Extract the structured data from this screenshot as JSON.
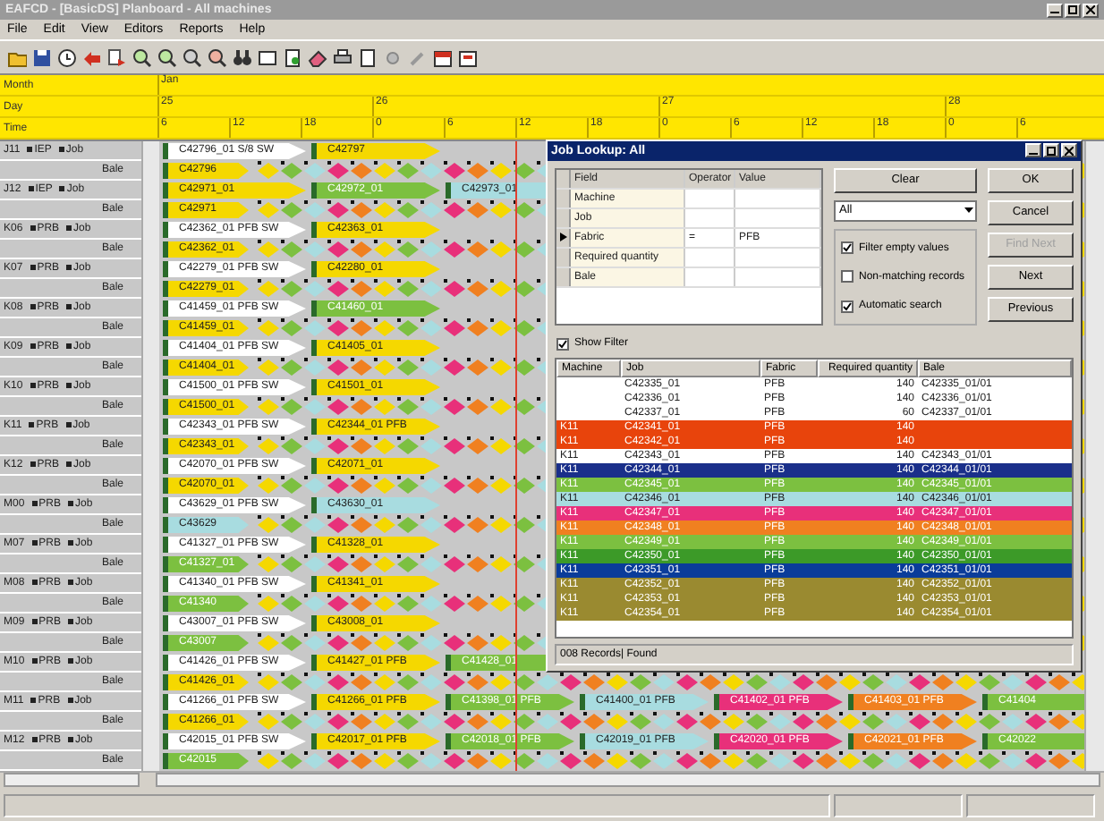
{
  "window": {
    "title": "EAFCD - [BasicDS] Planboard - All machines"
  },
  "menu": [
    "File",
    "Edit",
    "View",
    "Editors",
    "Reports",
    "Help"
  ],
  "time_scale": {
    "month_label": "Month",
    "day_label": "Day",
    "time_label": "Time",
    "month": "Jan",
    "days": [
      {
        "label": "25",
        "ticks": [
          "6",
          "12",
          "18"
        ]
      },
      {
        "label": "26",
        "ticks": [
          "0",
          "6",
          "12",
          "18"
        ]
      },
      {
        "label": "27",
        "ticks": [
          "0",
          "6",
          "12",
          "18"
        ]
      },
      {
        "label": "28",
        "ticks": [
          "0",
          "6"
        ]
      }
    ]
  },
  "machines": [
    {
      "name": "J11",
      "group": "IEP",
      "job_label": "Job",
      "bale_label": "Bale",
      "jobs": [
        {
          "label": "C42796_01 S/8 SW",
          "color": "#ffffff"
        },
        {
          "label": "C42797",
          "color": "#f5d800"
        }
      ],
      "bale": {
        "label": "C42796",
        "color": "#f5d800"
      }
    },
    {
      "name": "J12",
      "group": "IEP",
      "job_label": "Job",
      "bale_label": "Bale",
      "jobs": [
        {
          "label": "C42971_01",
          "color": "#f5d800"
        },
        {
          "label": "C42972_01",
          "color": "#7cc040"
        },
        {
          "label": "C42973_01",
          "color": "#a8dce0"
        }
      ],
      "bale": {
        "label": "C42971",
        "color": "#f5d800"
      }
    },
    {
      "name": "K06",
      "group": "PRB",
      "job_label": "Job",
      "bale_label": "Bale",
      "jobs": [
        {
          "label": "C42362_01 PFB SW",
          "color": "#ffffff"
        },
        {
          "label": "C42363_01",
          "color": "#f5d800"
        }
      ],
      "bale": {
        "label": "C42362_01",
        "color": "#f5d800"
      }
    },
    {
      "name": "K07",
      "group": "PRB",
      "job_label": "Job",
      "bale_label": "Bale",
      "jobs": [
        {
          "label": "C42279_01 PFB SW",
          "color": "#ffffff"
        },
        {
          "label": "C42280_01",
          "color": "#f5d800"
        }
      ],
      "bale": {
        "label": "C42279_01",
        "color": "#f5d800"
      }
    },
    {
      "name": "K08",
      "group": "PRB",
      "job_label": "Job",
      "bale_label": "Bale",
      "jobs": [
        {
          "label": "C41459_01 PFB SW",
          "color": "#ffffff"
        },
        {
          "label": "C41460_01",
          "color": "#7cc040"
        }
      ],
      "bale": {
        "label": "C41459_01",
        "color": "#f5d800"
      }
    },
    {
      "name": "K09",
      "group": "PRB",
      "job_label": "Job",
      "bale_label": "Bale",
      "jobs": [
        {
          "label": "C41404_01 PFB SW",
          "color": "#ffffff"
        },
        {
          "label": "C41405_01",
          "color": "#f5d800"
        }
      ],
      "bale": {
        "label": "C41404_01",
        "color": "#f5d800"
      }
    },
    {
      "name": "K10",
      "group": "PRB",
      "job_label": "Job",
      "bale_label": "Bale",
      "jobs": [
        {
          "label": "C41500_01 PFB SW",
          "color": "#ffffff"
        },
        {
          "label": "C41501_01",
          "color": "#f5d800"
        }
      ],
      "bale": {
        "label": "C41500_01",
        "color": "#f5d800"
      }
    },
    {
      "name": "K11",
      "group": "PRB",
      "job_label": "Job",
      "bale_label": "Bale",
      "jobs": [
        {
          "label": "C42343_01 PFB SW",
          "color": "#ffffff"
        },
        {
          "label": "C42344_01 PFB",
          "color": "#f5d800"
        }
      ],
      "bale": {
        "label": "C42343_01",
        "color": "#f5d800"
      }
    },
    {
      "name": "K12",
      "group": "PRB",
      "job_label": "Job",
      "bale_label": "Bale",
      "jobs": [
        {
          "label": "C42070_01 PFB SW",
          "color": "#ffffff"
        },
        {
          "label": "C42071_01",
          "color": "#f5d800"
        }
      ],
      "bale": {
        "label": "C42070_01",
        "color": "#f5d800"
      }
    },
    {
      "name": "M00",
      "group": "PRB",
      "job_label": "Job",
      "bale_label": "Bale",
      "jobs": [
        {
          "label": "C43629_01 PFB SW",
          "color": "#ffffff"
        },
        {
          "label": "C43630_01",
          "color": "#a8dce0"
        }
      ],
      "bale": {
        "label": "C43629",
        "color": "#a8dce0"
      }
    },
    {
      "name": "M07",
      "group": "PRB",
      "job_label": "Job",
      "bale_label": "Bale",
      "jobs": [
        {
          "label": "C41327_01 PFB SW",
          "color": "#ffffff"
        },
        {
          "label": "C41328_01",
          "color": "#f5d800"
        }
      ],
      "bale": {
        "label": "C41327_01",
        "color": "#7cc040"
      }
    },
    {
      "name": "M08",
      "group": "PRB",
      "job_label": "Job",
      "bale_label": "Bale",
      "jobs": [
        {
          "label": "C41340_01 PFB SW",
          "color": "#ffffff"
        },
        {
          "label": "C41341_01",
          "color": "#f5d800"
        }
      ],
      "bale": {
        "label": "C41340",
        "color": "#7cc040"
      }
    },
    {
      "name": "M09",
      "group": "PRB",
      "job_label": "Job",
      "bale_label": "Bale",
      "jobs": [
        {
          "label": "C43007_01 PFB SW",
          "color": "#ffffff"
        },
        {
          "label": "C43008_01",
          "color": "#f5d800"
        }
      ],
      "bale": {
        "label": "C43007",
        "color": "#7cc040"
      }
    },
    {
      "name": "M10",
      "group": "PRB",
      "job_label": "Job",
      "bale_label": "Bale",
      "jobs": [
        {
          "label": "C41426_01 PFB SW",
          "color": "#ffffff"
        },
        {
          "label": "C41427_01 PFB",
          "color": "#f5d800"
        },
        {
          "label": "C41428_01",
          "color": "#7cc040"
        }
      ],
      "bale": {
        "label": "C41426_01",
        "color": "#f5d800"
      }
    },
    {
      "name": "M11",
      "group": "PRB",
      "job_label": "Job",
      "bale_label": "Bale",
      "jobs": [
        {
          "label": "C41266_01 PFB SW",
          "color": "#ffffff"
        },
        {
          "label": "C41266_01 PFB",
          "color": "#f5d800"
        },
        {
          "label": "C41398_01 PFB",
          "color": "#7cc040"
        },
        {
          "label": "C41400_01 PFB",
          "color": "#a8dce0"
        },
        {
          "label": "C41402_01 PFB",
          "color": "#e8307a"
        },
        {
          "label": "C41403_01 PFB",
          "color": "#f08020"
        },
        {
          "label": "C41404",
          "color": "#7cc040"
        }
      ],
      "bale": {
        "label": "C41266_01",
        "color": "#f5d800"
      }
    },
    {
      "name": "M12",
      "group": "PRB",
      "job_label": "Job",
      "bale_label": "Bale",
      "jobs": [
        {
          "label": "C42015_01 PFB SW",
          "color": "#ffffff"
        },
        {
          "label": "C42017_01 PFB",
          "color": "#f5d800"
        },
        {
          "label": "C42018_01 PFB",
          "color": "#7cc040"
        },
        {
          "label": "C42019_01 PFB",
          "color": "#a8dce0"
        },
        {
          "label": "C42020_01 PFB",
          "color": "#e8307a"
        },
        {
          "label": "C42021_01 PFB",
          "color": "#f08020"
        },
        {
          "label": "C42022",
          "color": "#7cc040"
        }
      ],
      "bale": {
        "label": "C42015",
        "color": "#7cc040"
      }
    }
  ],
  "lookup_dialog": {
    "title": "Job Lookup: All",
    "filter_columns": [
      "Field",
      "Operator",
      "Value"
    ],
    "filter_rows": [
      {
        "field": "Machine",
        "selected": false
      },
      {
        "field": "Job",
        "selected": false
      },
      {
        "field": "Fabric",
        "operator": "=",
        "value": "PFB",
        "selected": true
      },
      {
        "field": "Required quantity",
        "selected": false
      },
      {
        "field": "Bale",
        "selected": false
      }
    ],
    "clear_button": "Clear",
    "scope": "All",
    "options": [
      {
        "label": "Filter empty values",
        "checked": true
      },
      {
        "label": "Non-matching records",
        "checked": false
      },
      {
        "label": "Automatic search",
        "checked": true
      }
    ],
    "buttons": [
      {
        "label": "OK",
        "disabled": false
      },
      {
        "label": "Cancel",
        "disabled": false
      },
      {
        "label": "Find Next",
        "disabled": true
      },
      {
        "label": "Next",
        "disabled": false
      },
      {
        "label": "Previous",
        "disabled": false
      }
    ],
    "show_filter": {
      "label": "Show Filter",
      "checked": true
    },
    "result_columns": [
      "Machine",
      "Job",
      "Fabric",
      "Required quantity",
      "Bale"
    ],
    "results": [
      {
        "job": "C42335_01",
        "fabric": "PFB",
        "quantity": "140",
        "bale": "C42335_01/01",
        "color": "#ffffff"
      },
      {
        "job": "C42336_01",
        "fabric": "PFB",
        "quantity": "140",
        "bale": "C42336_01/01",
        "color": "#ffffff"
      },
      {
        "job": "C42337_01",
        "fabric": "PFB",
        "quantity": "60",
        "bale": "C42337_01/01",
        "color": "#ffffff"
      },
      {
        "machine": "K11",
        "job": "C42341_01",
        "fabric": "PFB",
        "quantity": "140",
        "color": "#e8440c"
      },
      {
        "machine": "K11",
        "job": "C42342_01",
        "fabric": "PFB",
        "quantity": "140",
        "color": "#e8440c"
      },
      {
        "machine": "K11",
        "job": "C42343_01",
        "fabric": "PFB",
        "quantity": "140",
        "bale": "C42343_01/01",
        "color": "#ffffff"
      },
      {
        "machine": "K11",
        "job": "C42344_01",
        "fabric": "PFB",
        "quantity": "140",
        "bale": "C42344_01/01",
        "color": "#1a2f8a"
      },
      {
        "machine": "K11",
        "job": "C42345_01",
        "fabric": "PFB",
        "quantity": "140",
        "bale": "C42345_01/01",
        "color": "#7cc040"
      },
      {
        "machine": "K11",
        "job": "C42346_01",
        "fabric": "PFB",
        "quantity": "140",
        "bale": "C42346_01/01",
        "color": "#a8dce0"
      },
      {
        "machine": "K11",
        "job": "C42347_01",
        "fabric": "PFB",
        "quantity": "140",
        "bale": "C42347_01/01",
        "color": "#e8307a"
      },
      {
        "machine": "K11",
        "job": "C42348_01",
        "fabric": "PFB",
        "quantity": "140",
        "bale": "C42348_01/01",
        "color": "#f08020"
      },
      {
        "machine": "K11",
        "job": "C42349_01",
        "fabric": "PFB",
        "quantity": "140",
        "bale": "C42349_01/01",
        "color": "#7cc040"
      },
      {
        "machine": "K11",
        "job": "C42350_01",
        "fabric": "PFB",
        "quantity": "140",
        "bale": "C42350_01/01",
        "color": "#3c9a28"
      },
      {
        "machine": "K11",
        "job": "C42351_01",
        "fabric": "PFB",
        "quantity": "140",
        "bale": "C42351_01/01",
        "color": "#0a3c9a"
      },
      {
        "machine": "K11",
        "job": "C42352_01",
        "fabric": "PFB",
        "quantity": "140",
        "bale": "C42352_01/01",
        "color": "#9a8a30"
      },
      {
        "machine": "K11",
        "job": "C42353_01",
        "fabric": "PFB",
        "quantity": "140",
        "bale": "C42353_01/01",
        "color": "#9a8a30"
      },
      {
        "machine": "K11",
        "job": "C42354_01",
        "fabric": "PFB",
        "quantity": "140",
        "bale": "C42354_01/01",
        "color": "#9a8a30"
      }
    ],
    "status": "008 Records| Found"
  }
}
